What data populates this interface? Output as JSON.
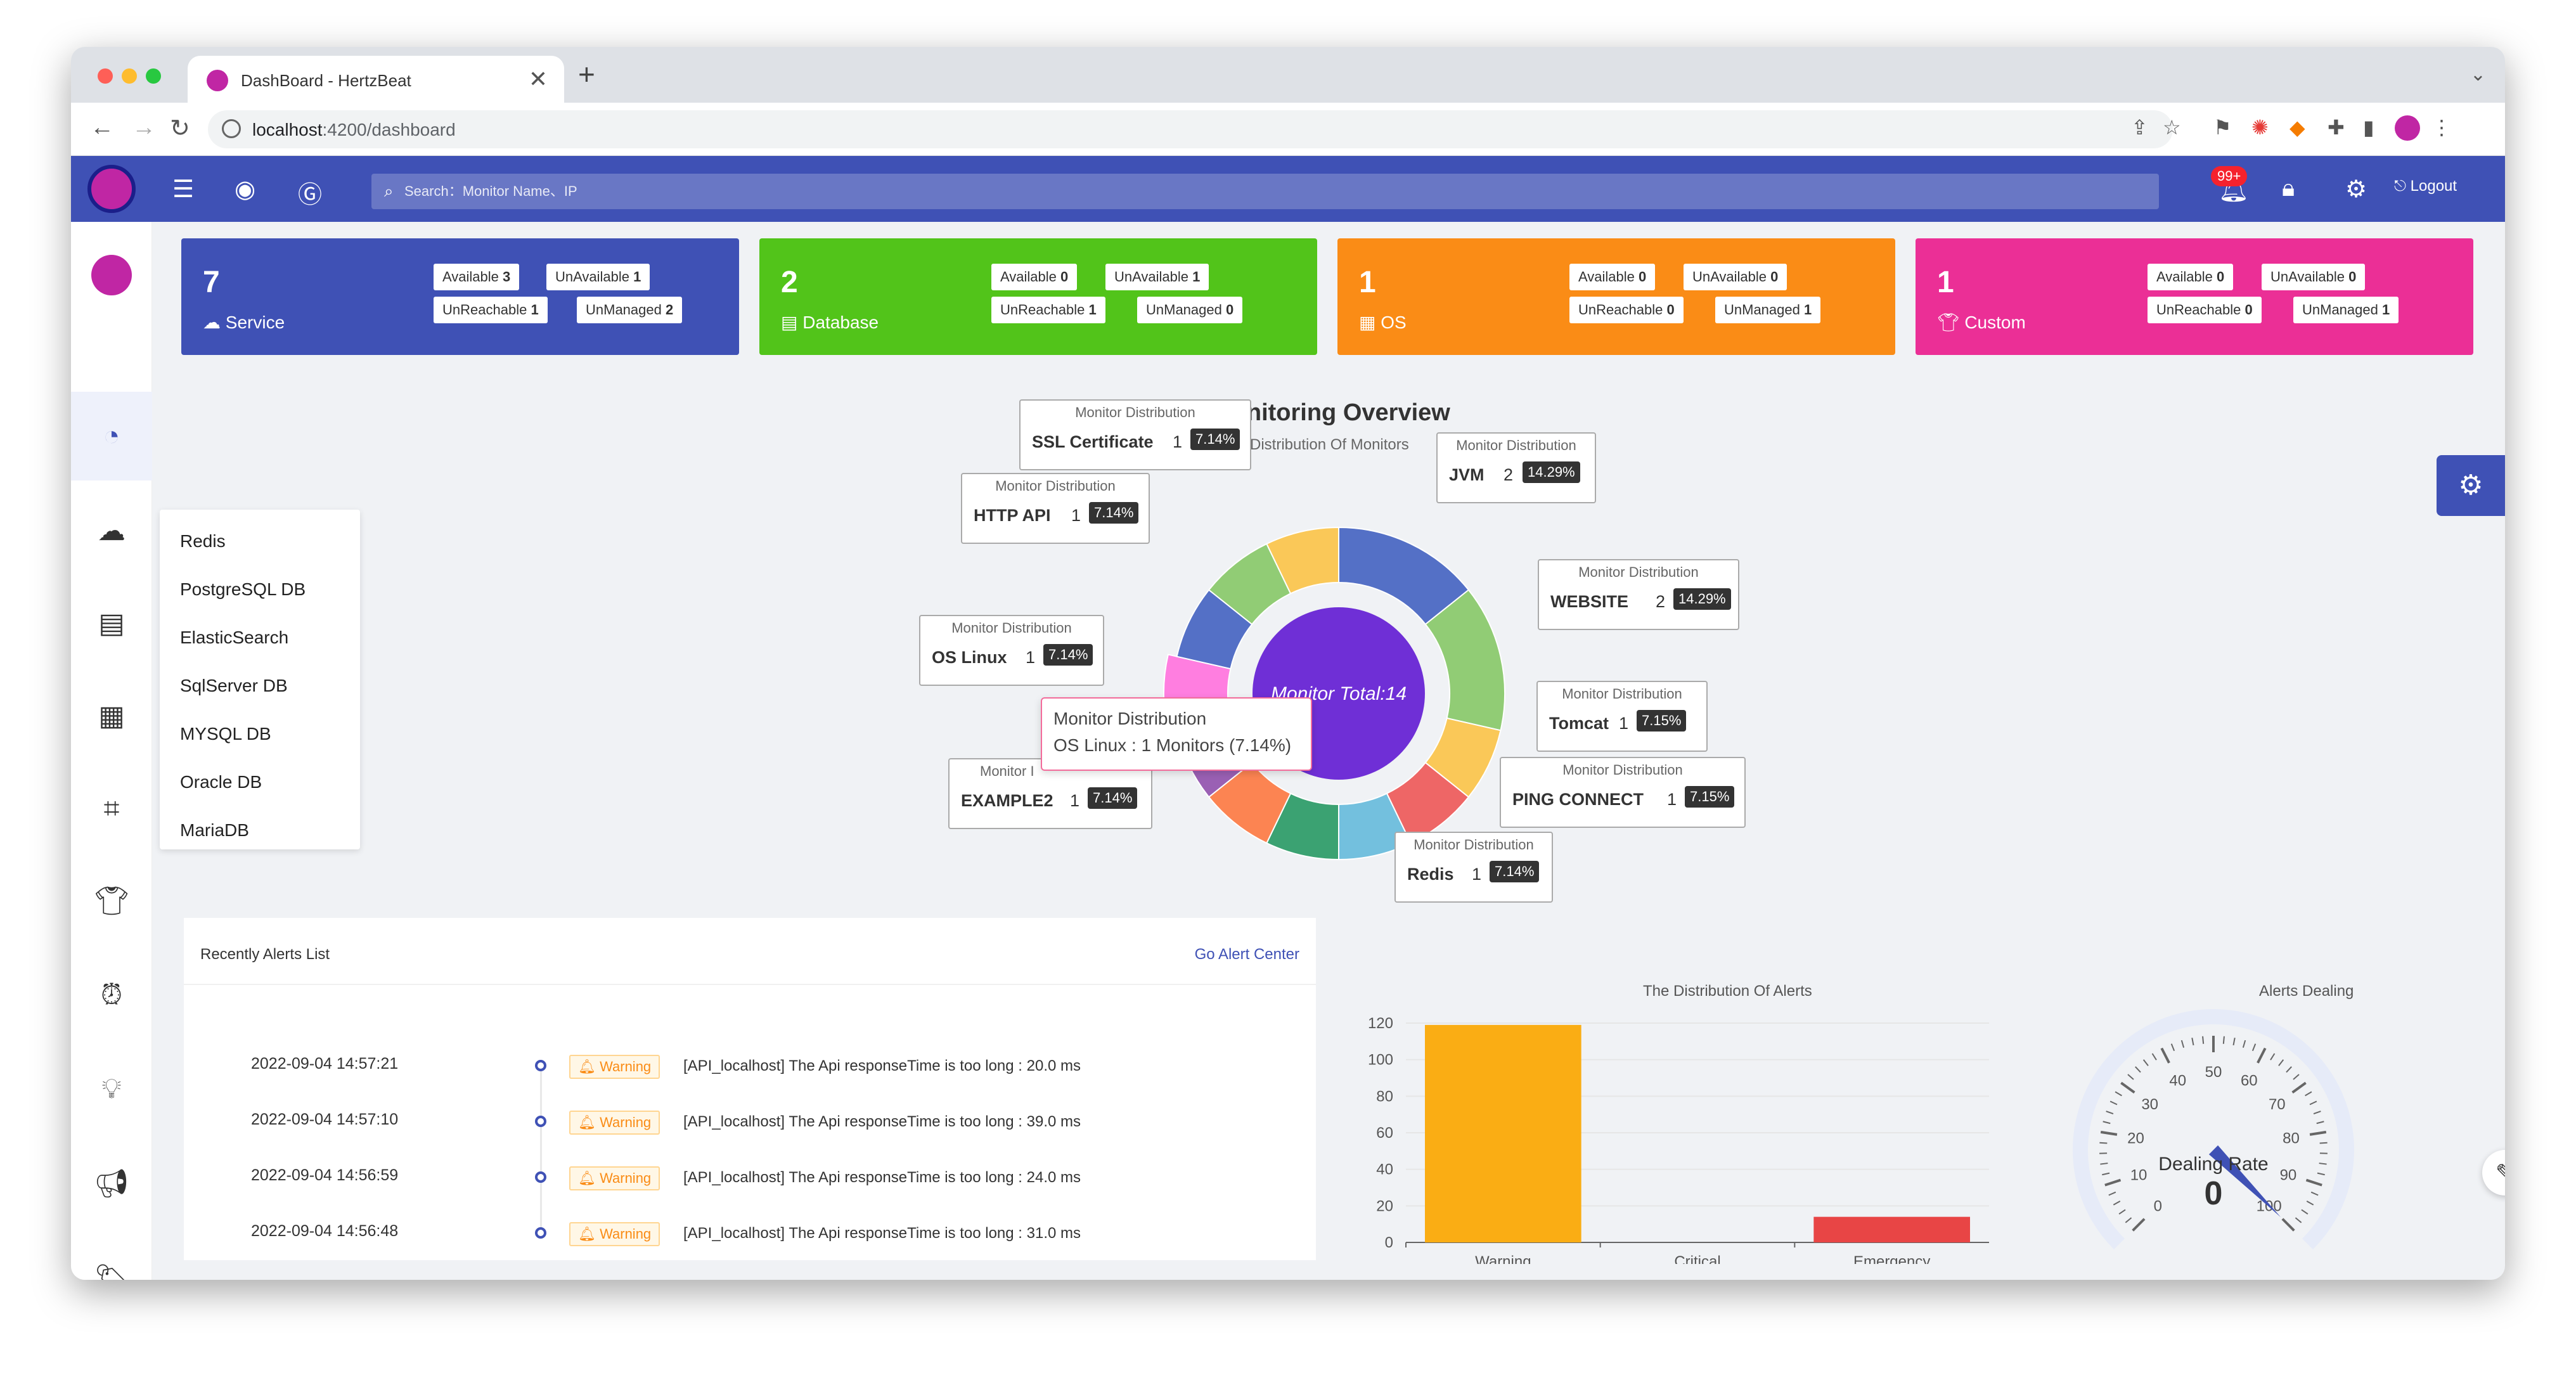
{
  "browser": {
    "tab_title": "DashBoard - HertzBeat",
    "tab_close": "✕",
    "new_tab": "+",
    "url_host": "localhost",
    "url_path": ":4200/dashboard"
  },
  "header": {
    "search_placeholder": "Search：Monitor Name、IP",
    "notification_badge": "99+",
    "logout_label": "Logout"
  },
  "db_menu": [
    "Redis",
    "PostgreSQL DB",
    "ElasticSearch",
    "SqlServer DB",
    "MYSQL DB",
    "Oracle DB",
    "MariaDB"
  ],
  "cards": [
    {
      "count": "7",
      "label": "Service",
      "color": "#3f51b5",
      "available": "3",
      "unavailable": "1",
      "unreachable": "1",
      "unmanaged": "2"
    },
    {
      "count": "2",
      "label": "Database",
      "color": "#52c41a",
      "available": "0",
      "unavailable": "1",
      "unreachable": "1",
      "unmanaged": "0"
    },
    {
      "count": "1",
      "label": "OS",
      "color": "#fa8c16",
      "available": "0",
      "unavailable": "0",
      "unreachable": "0",
      "unmanaged": "1"
    },
    {
      "count": "1",
      "label": "Custom",
      "color": "#eb2f96",
      "available": "0",
      "unavailable": "0",
      "unreachable": "0",
      "unmanaged": "1"
    }
  ],
  "tag_labels": {
    "available": "Available",
    "unavailable": "UnAvailable",
    "unreachable": "UnReachable",
    "unmanaged": "UnManaged"
  },
  "overview": {
    "title": "Monitoring Overview",
    "subtitle": "e Distribution Of Monitors",
    "center_label": "Monitor Total:14",
    "label_head": "Monitor Distribution",
    "tooltip_title": "Monitor Distribution",
    "tooltip_body": "OS Linux : 1 Monitors (7.14%)",
    "partial_label": "Monitor I"
  },
  "chart_data": [
    {
      "type": "pie",
      "title": "Monitoring Overview",
      "slices": [
        {
          "name": "JVM",
          "value": 2,
          "percent": "14.29%",
          "color": "#5470c6"
        },
        {
          "name": "WEBSITE",
          "value": 2,
          "percent": "14.29%",
          "color": "#91cc75"
        },
        {
          "name": "Tomcat",
          "value": 1,
          "percent": "7.15%",
          "color": "#fac858"
        },
        {
          "name": "PING CONNECT",
          "value": 1,
          "percent": "7.15%",
          "color": "#ee6666"
        },
        {
          "name": "Redis",
          "value": 1,
          "percent": "7.14%",
          "color": "#73c0de"
        },
        {
          "name": "",
          "value": 1,
          "percent": "",
          "color": "#3ba272"
        },
        {
          "name": "",
          "value": 1,
          "percent": "",
          "color": "#fc8452"
        },
        {
          "name": "EXAMPLE2",
          "value": 1,
          "percent": "7.14%",
          "color": "#9a60b4"
        },
        {
          "name": "OS Linux",
          "value": 1,
          "percent": "7.14%",
          "color": "#ff7ee0"
        },
        {
          "name": "HTTP API",
          "value": 1,
          "percent": "7.14%",
          "color": "#5470c6"
        },
        {
          "name": "",
          "value": 1,
          "percent": "",
          "color": "#91cc75"
        },
        {
          "name": "SSL Certificate",
          "value": 1,
          "percent": "7.14%",
          "color": "#fac858"
        }
      ]
    },
    {
      "type": "bar",
      "title": "The Distribution Of Alerts",
      "categories": [
        "Warning",
        "Critical",
        "Emergency"
      ],
      "values": [
        119,
        0,
        14
      ],
      "colors": [
        "#faad14",
        "#fa8c16",
        "#e84545"
      ],
      "ylim": [
        0,
        120
      ],
      "yticks": [
        "0",
        "20",
        "40",
        "60",
        "80",
        "100",
        "120"
      ]
    },
    {
      "type": "gauge",
      "title": "Alerts Dealing",
      "label": "Dealing Rate",
      "value": 0,
      "ticks": [
        "0",
        "10",
        "20",
        "30",
        "40",
        "50",
        "60",
        "70",
        "80",
        "90",
        "100"
      ]
    }
  ],
  "alerts": {
    "title": "Recently Alerts List",
    "link": "Go Alert Center",
    "items": [
      {
        "time": "2022-09-04 14:57:21",
        "level": "Warning",
        "message": "[API_localhost] The Api responseTime is too long : 20.0 ms"
      },
      {
        "time": "2022-09-04 14:57:10",
        "level": "Warning",
        "message": "[API_localhost] The Api responseTime is too long : 39.0 ms"
      },
      {
        "time": "2022-09-04 14:56:59",
        "level": "Warning",
        "message": "[API_localhost] The Api responseTime is too long : 24.0 ms"
      },
      {
        "time": "2022-09-04 14:56:48",
        "level": "Warning",
        "message": "[API_localhost] The Api responseTime is too long : 31.0 ms"
      }
    ]
  }
}
